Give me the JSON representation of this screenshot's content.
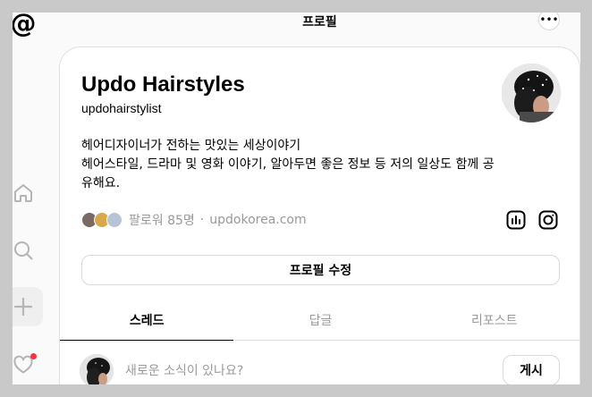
{
  "header": {
    "title": "프로필",
    "more_label": "•••"
  },
  "sidebar": {
    "items": [
      {
        "icon": "home-icon"
      },
      {
        "icon": "search-icon"
      },
      {
        "icon": "plus-icon"
      },
      {
        "icon": "heart-icon"
      }
    ],
    "notification_color": "#ff3040"
  },
  "profile": {
    "name": "Updo Hairstyles",
    "handle": "updohairstylist",
    "bio_lines": [
      "헤어디자이너가 전하는 맛있는 세상이야기",
      "헤어스타일, 드라마 및 영화 이야기, 알아두면 좋은 정보 등 저의 일상도 함께 공",
      "유해요."
    ],
    "followers": "팔로워 85명",
    "separator": "·",
    "link": "updokorea.com",
    "edit_button": "프로필 수정"
  },
  "tabs": [
    {
      "label": "스레드",
      "active": true
    },
    {
      "label": "답글",
      "active": false
    },
    {
      "label": "리포스트",
      "active": false
    }
  ],
  "composer": {
    "placeholder": "새로운 소식이 있나요?",
    "post_button": "게시"
  }
}
